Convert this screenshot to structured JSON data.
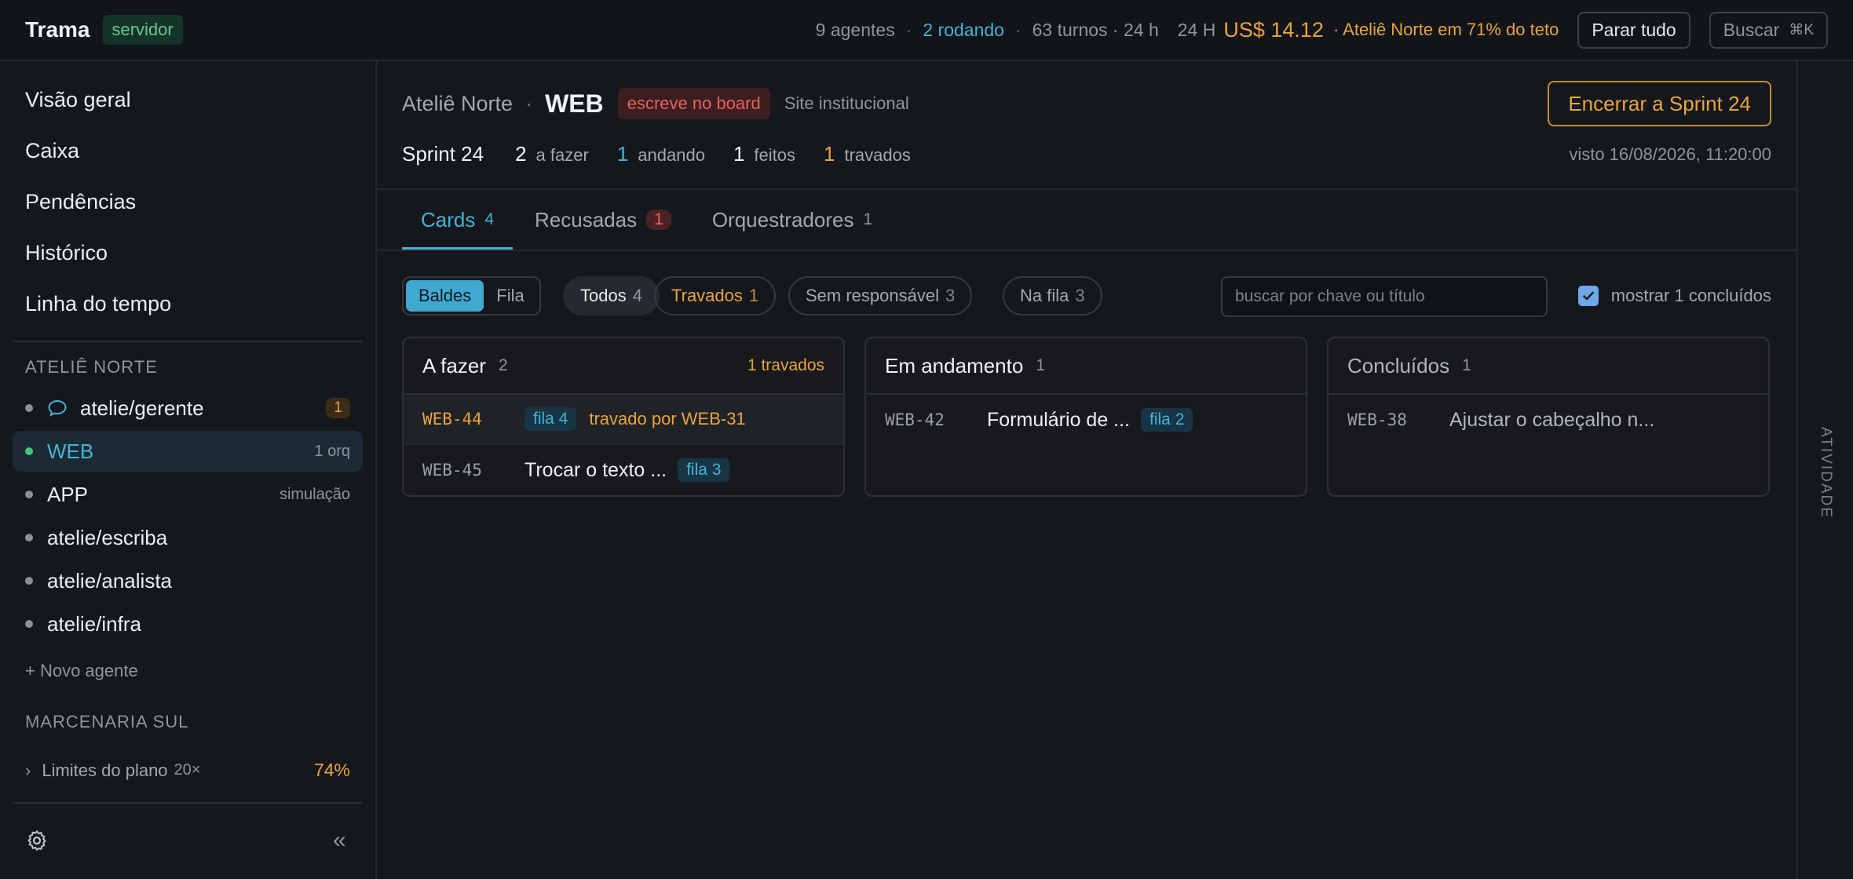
{
  "topbar": {
    "brand": "Trama",
    "badge": "servidor",
    "agents": "9 agentes",
    "running": "2 rodando",
    "turns": "63 turnos · 24 h",
    "cost_label": "24 H",
    "cost": "US$ 14.12",
    "cost_warning": "· Ateliê Norte em 71% do teto",
    "stop_all": "Parar tudo",
    "search": "Buscar",
    "search_kbd": "⌘K"
  },
  "sidebar": {
    "nav": [
      "Visão geral",
      "Caixa",
      "Pendências",
      "Histórico",
      "Linha do tempo"
    ],
    "groups": [
      {
        "label": "ATELIÊ NORTE",
        "items": [
          {
            "name": "atelie/gerente",
            "count": "1",
            "icon": "chat-icon"
          },
          {
            "name": "WEB",
            "meta": "1 orq",
            "active": true
          },
          {
            "name": "APP",
            "meta": "simulação"
          },
          {
            "name": "atelie/escriba"
          },
          {
            "name": "atelie/analista"
          },
          {
            "name": "atelie/infra"
          }
        ],
        "new_agent": "+ Novo agente"
      },
      {
        "label": "MARCENARIA SUL"
      }
    ],
    "plan": {
      "label": "Limites do plano",
      "multiplier": "20×",
      "percent": "74%"
    }
  },
  "header": {
    "org": "Ateliê Norte",
    "project": "WEB",
    "badge": "escreve no board",
    "subtitle": "Site institucional",
    "end_sprint": "Encerrar a Sprint 24",
    "sprint": "Sprint 24",
    "stats": [
      {
        "n": "2",
        "label": "a fazer"
      },
      {
        "n": "1",
        "label": "andando"
      },
      {
        "n": "1",
        "label": "feitos"
      },
      {
        "n": "1",
        "label": "travados"
      }
    ],
    "seen": "visto 16/08/2026, 11:20:00"
  },
  "tabs": [
    {
      "label": "Cards",
      "count": "4"
    },
    {
      "label": "Recusadas",
      "count": "1"
    },
    {
      "label": "Orquestradores",
      "count": "1"
    }
  ],
  "filters": {
    "views": [
      "Baldes",
      "Fila"
    ],
    "chips": [
      {
        "label": "Todos",
        "count": "4"
      },
      {
        "label": "Travados",
        "count": "1"
      },
      {
        "label": "Sem responsável",
        "count": "3"
      },
      {
        "label": "Na fila",
        "count": "3"
      }
    ],
    "search_placeholder": "buscar por chave ou título",
    "show_done": "mostrar 1 concluídos"
  },
  "board": [
    {
      "title": "A fazer",
      "count": "2",
      "extra": "1 travados",
      "cards": [
        {
          "key": "WEB-44",
          "queue": "fila 4",
          "blocked_by": "travado por WEB-31"
        },
        {
          "key": "WEB-45",
          "title": "Trocar o texto ...",
          "queue": "fila 3"
        }
      ]
    },
    {
      "title": "Em andamento",
      "count": "1",
      "cards": [
        {
          "key": "WEB-42",
          "title": "Formulário de ...",
          "queue": "fila 2"
        }
      ]
    },
    {
      "title": "Concluídos",
      "count": "1",
      "cards": [
        {
          "key": "WEB-38",
          "title": "Ajustar o cabeçalho n..."
        }
      ]
    }
  ],
  "rail": {
    "label": "ATIVIDADE"
  },
  "colors": {
    "accent": "#43b3d6",
    "warning": "#e8a33c",
    "danger": "#e8605a",
    "success": "#46c47c"
  }
}
